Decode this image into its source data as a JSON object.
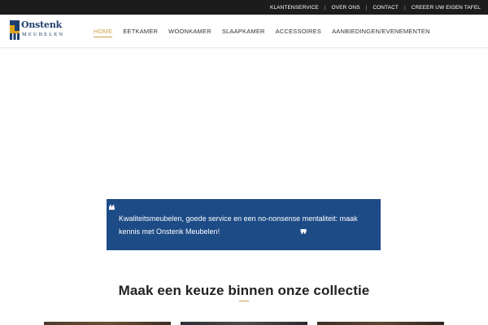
{
  "topbar": {
    "links": [
      "KLANTENSERVICE",
      "OVER ONS",
      "CONTACT",
      "CREEER UW EIGEN TAFEL"
    ],
    "separator": "|"
  },
  "logo": {
    "name": "Onstenk",
    "subtitle": "MEUBELEN"
  },
  "nav": {
    "items": [
      "HOME",
      "EETKAMER",
      "WOONKAMER",
      "SLAAPKAMER",
      "ACCESSOIRES",
      "AANBIEDINGEN/EVENEMENTEN"
    ],
    "active_index": 0
  },
  "quote": {
    "open_mark": "❝",
    "close_mark": "❞",
    "text": "Kwaliteitsmeubelen, goede service en een no-nonsense mentaliteit: maak kennis met Onstenk Meubelen!"
  },
  "collection": {
    "title": "Maak een keuze binnen onze collectie"
  },
  "colors": {
    "topbar": "#1c1c1c",
    "accent": "#c9a14c",
    "brand_blue": "#1d4b86",
    "logo_blue": "#1d3e6e"
  }
}
